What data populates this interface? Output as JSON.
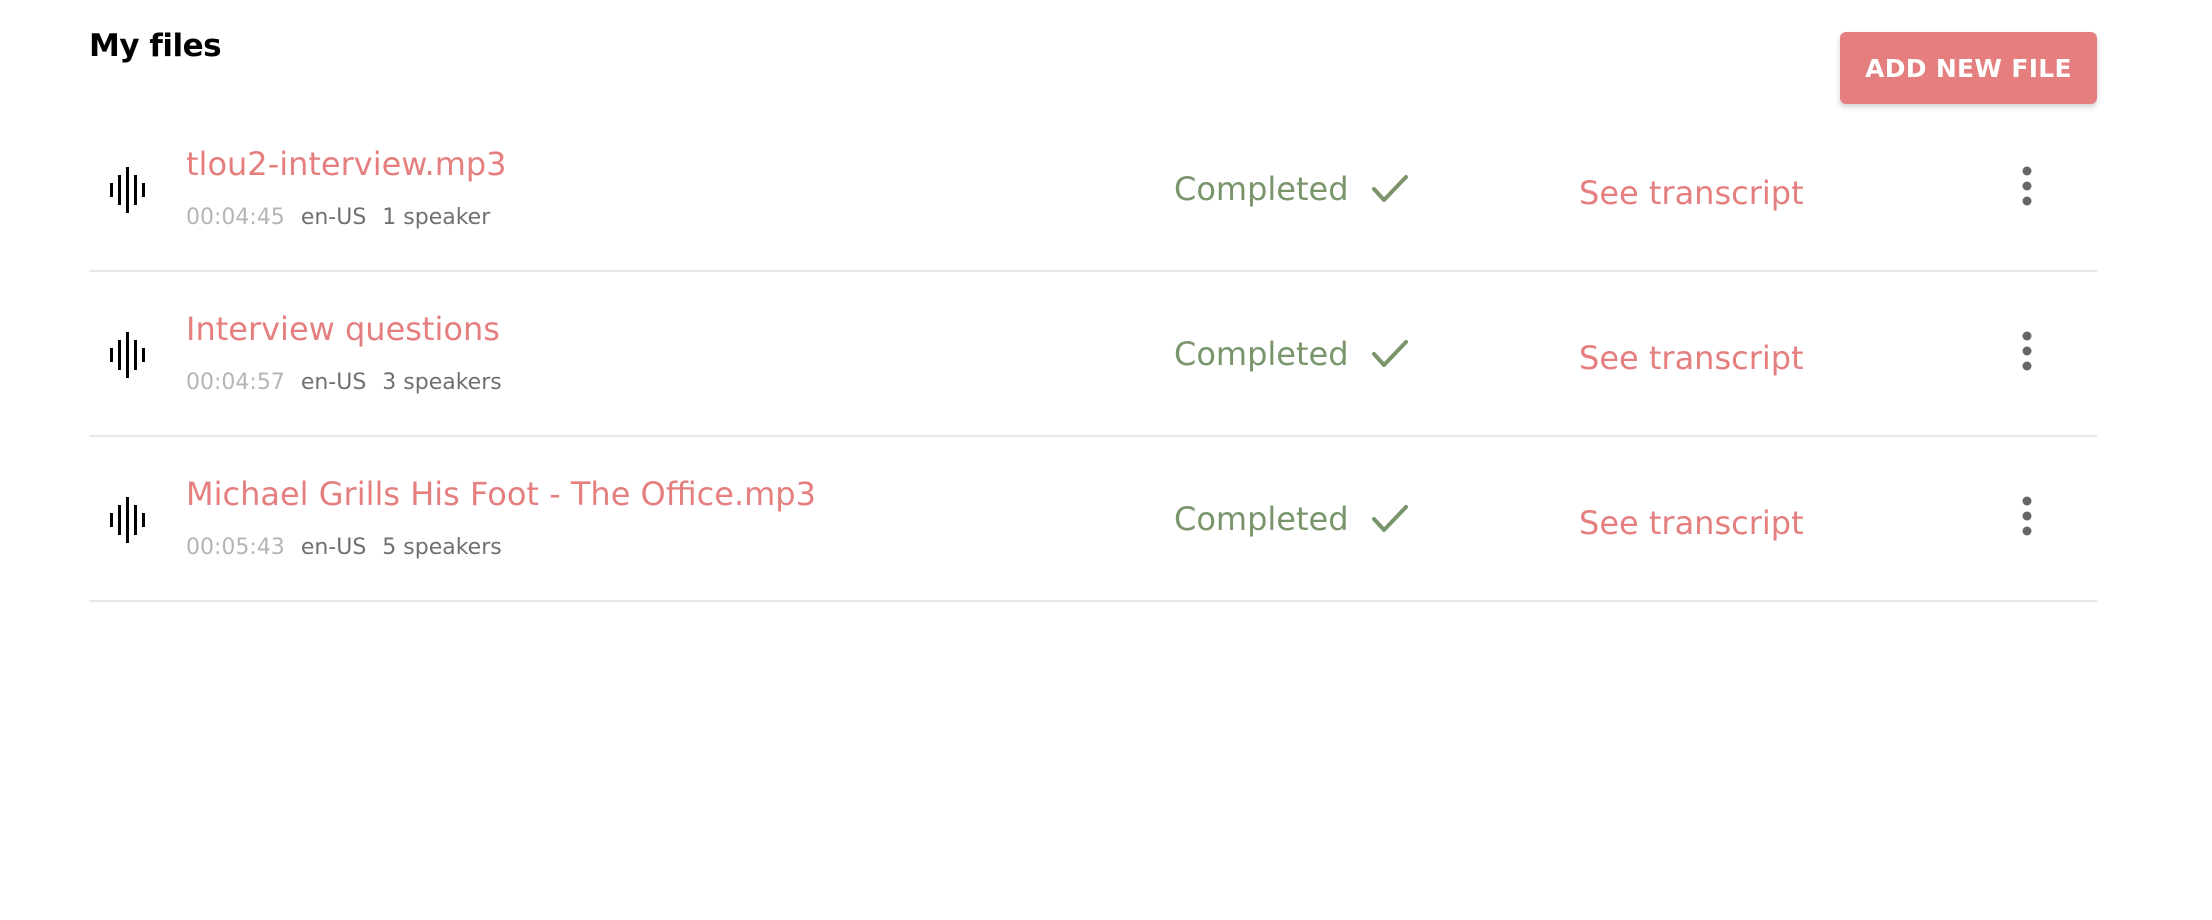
{
  "header": {
    "title": "My files",
    "add_button_label": "ADD NEW FILE"
  },
  "files": [
    {
      "name": "tlou2-interview.mp3",
      "duration": "00:04:45",
      "language": "en-US",
      "speakers": "1 speaker",
      "status": "Completed",
      "action_label": "See transcript",
      "icon": "audio-waveform-icon"
    },
    {
      "name": "Interview questions",
      "duration": "00:04:57",
      "language": "en-US",
      "speakers": "3 speakers",
      "status": "Completed",
      "action_label": "See transcript",
      "icon": "audio-waveform-icon"
    },
    {
      "name": "Michael Grills His Foot - The Office.mp3",
      "duration": "00:05:43",
      "language": "en-US",
      "speakers": "5 speakers",
      "status": "Completed",
      "action_label": "See transcript",
      "icon": "audio-waveform-icon"
    }
  ],
  "colors": {
    "accent": "#e57f7f",
    "status_completed": "#7a956c",
    "muted": "#b5b5b5",
    "secondary_text": "#707070",
    "divider": "#e8e8e8"
  }
}
